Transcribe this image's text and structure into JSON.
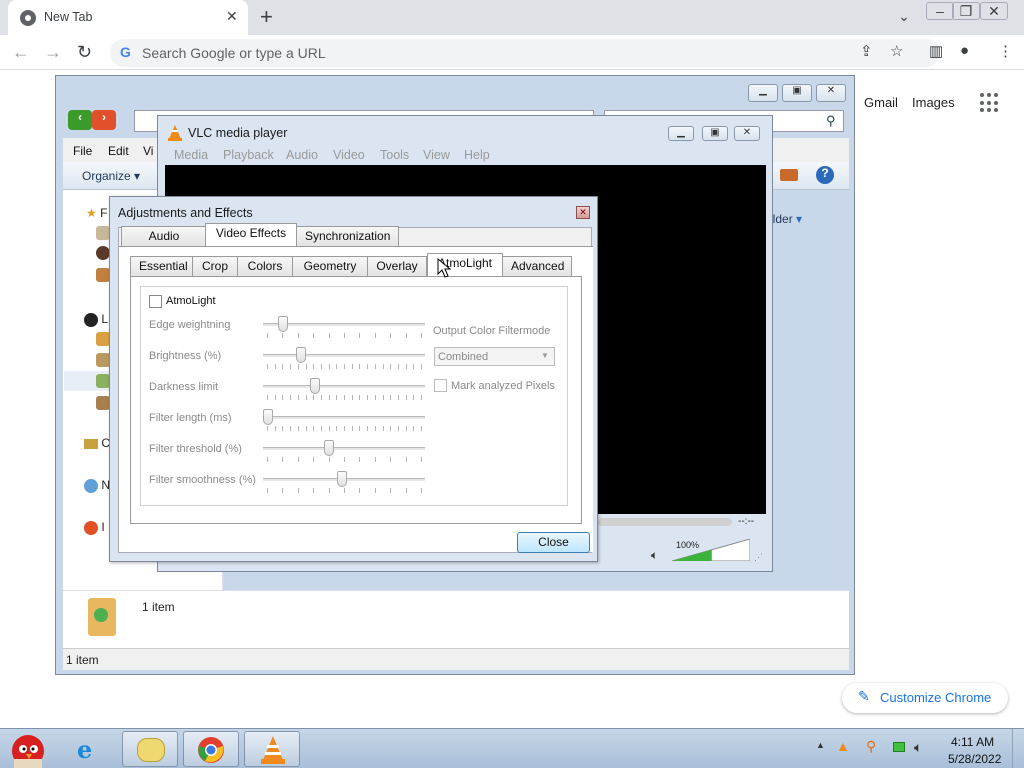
{
  "chrome": {
    "tab_title": "New Tab",
    "omnibox_placeholder": "Search Google or type a URL",
    "gmail": "Gmail",
    "images": "Images",
    "customize": "Customize Chrome"
  },
  "explorer": {
    "menu": [
      "File",
      "Edit",
      "Vi"
    ],
    "organize": "Organize",
    "right_label": "older",
    "nav_rows": [
      "F",
      "L",
      "C",
      "N",
      "I"
    ],
    "details_items": "1 item",
    "status": "1 item"
  },
  "vlc": {
    "title": "VLC media player",
    "menu": [
      "Media",
      "Playback",
      "Audio",
      "Video",
      "Tools",
      "View",
      "Help"
    ],
    "time": "--:--",
    "volume": "100%",
    "volume_level": 1.0
  },
  "adjust": {
    "title": "Adjustments and Effects",
    "main_tabs": [
      "Audio Effects",
      "Video Effects",
      "Synchronization"
    ],
    "main_active": "Video Effects",
    "sub_tabs": [
      "Essential",
      "Crop",
      "Colors",
      "Geometry",
      "Overlay",
      "AtmoLight",
      "Advanced"
    ],
    "sub_active": "AtmoLight",
    "enable_label": "AtmoLight",
    "enable_checked": false,
    "sliders": [
      {
        "label": "Edge weightning",
        "value": 0.1
      },
      {
        "label": "Brightness (%)",
        "value": 0.22
      },
      {
        "label": "Darkness limit",
        "value": 0.31
      },
      {
        "label": "Filter length (ms)",
        "value": 0.0
      },
      {
        "label": "Filter threshold (%)",
        "value": 0.4
      },
      {
        "label": "Filter smoothness (%)",
        "value": 0.49
      }
    ],
    "output_label": "Output Color Filtermode",
    "filtermode": "Combined",
    "mark_label": "Mark analyzed Pixels",
    "mark_checked": false,
    "close": "Close"
  },
  "taskbar": {
    "time": "4:11 AM",
    "date": "5/28/2022"
  },
  "colors": {
    "vlc_orange": "#f08a1a",
    "accent_blue": "#1a73e8"
  }
}
